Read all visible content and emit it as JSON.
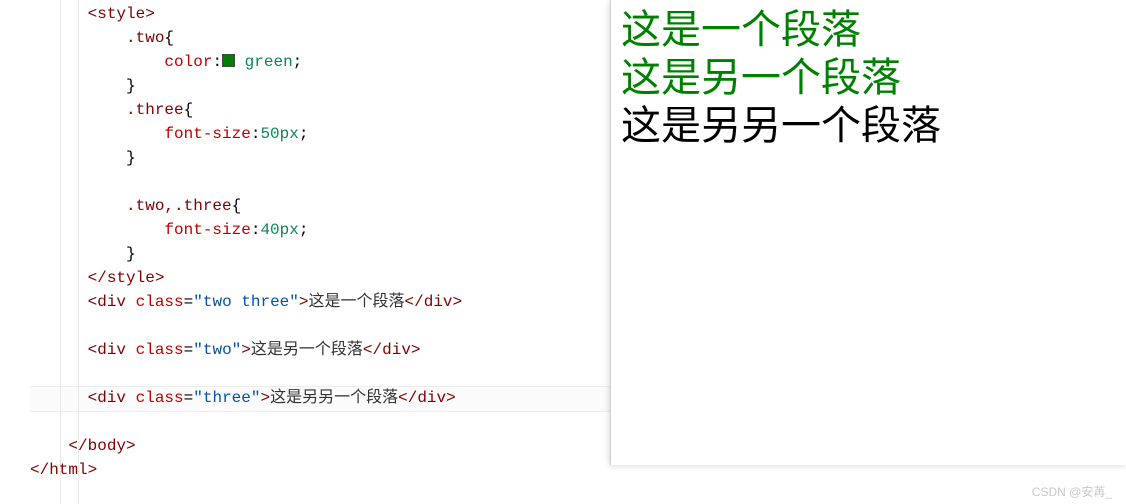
{
  "code": {
    "l1_open_style": "<style>",
    "l2_pre": "    ",
    "l2_sel": ".two",
    "l2_brace": "{",
    "l3_pre": "        ",
    "l3_prop": "color",
    "l3_colon": ":",
    "l3_val": "green",
    "l3_semi": ";",
    "l4_pre": "    ",
    "l4_brace": "}",
    "l5_pre": "    ",
    "l5_sel": ".three",
    "l5_brace": "{",
    "l6_pre": "        ",
    "l6_prop": "font-size",
    "l6_colon": ":",
    "l6_val": "50px",
    "l6_semi": ";",
    "l7_pre": "    ",
    "l7_brace": "}",
    "l8_blank": " ",
    "l9_pre": "    ",
    "l9_sel": ".two,.three",
    "l9_brace": "{",
    "l10_pre": "        ",
    "l10_prop": "font-size",
    "l10_colon": ":",
    "l10_val": "40px",
    "l10_semi": ";",
    "l11_pre": "    ",
    "l11_brace": "}",
    "l12_close_style": "</style>",
    "l13_open": "<div ",
    "l13_attr": "class",
    "l13_eq": "=",
    "l13_q1": "\"",
    "l13_val": "two three",
    "l13_q2": "\"",
    "l13_gt": ">",
    "l13_text": "这是一个段落",
    "l13_close": "</div>",
    "l14_blank": " ",
    "l15_open": "<div ",
    "l15_attr": "class",
    "l15_eq": "=",
    "l15_q1": "\"",
    "l15_val": "two",
    "l15_q2": "\"",
    "l15_gt": ">",
    "l15_text": "这是另一个段落",
    "l15_close": "</div>",
    "l16_blank": " ",
    "l17_open": "<div ",
    "l17_attr": "class",
    "l17_eq": "=",
    "l17_q1": "\"",
    "l17_val": "three",
    "l17_q2": "\"",
    "l17_gt": ">",
    "l17_text": "这是另另一个段落",
    "l17_close": "</div>",
    "l18_blank": " ",
    "l19_close_body": "</body>",
    "l20_close_html": "</html>"
  },
  "preview": {
    "p1": "这是一个段落",
    "p2": "这是另一个段落",
    "p3": "这是另另一个段落"
  },
  "watermark": "CSDN @安苒_"
}
